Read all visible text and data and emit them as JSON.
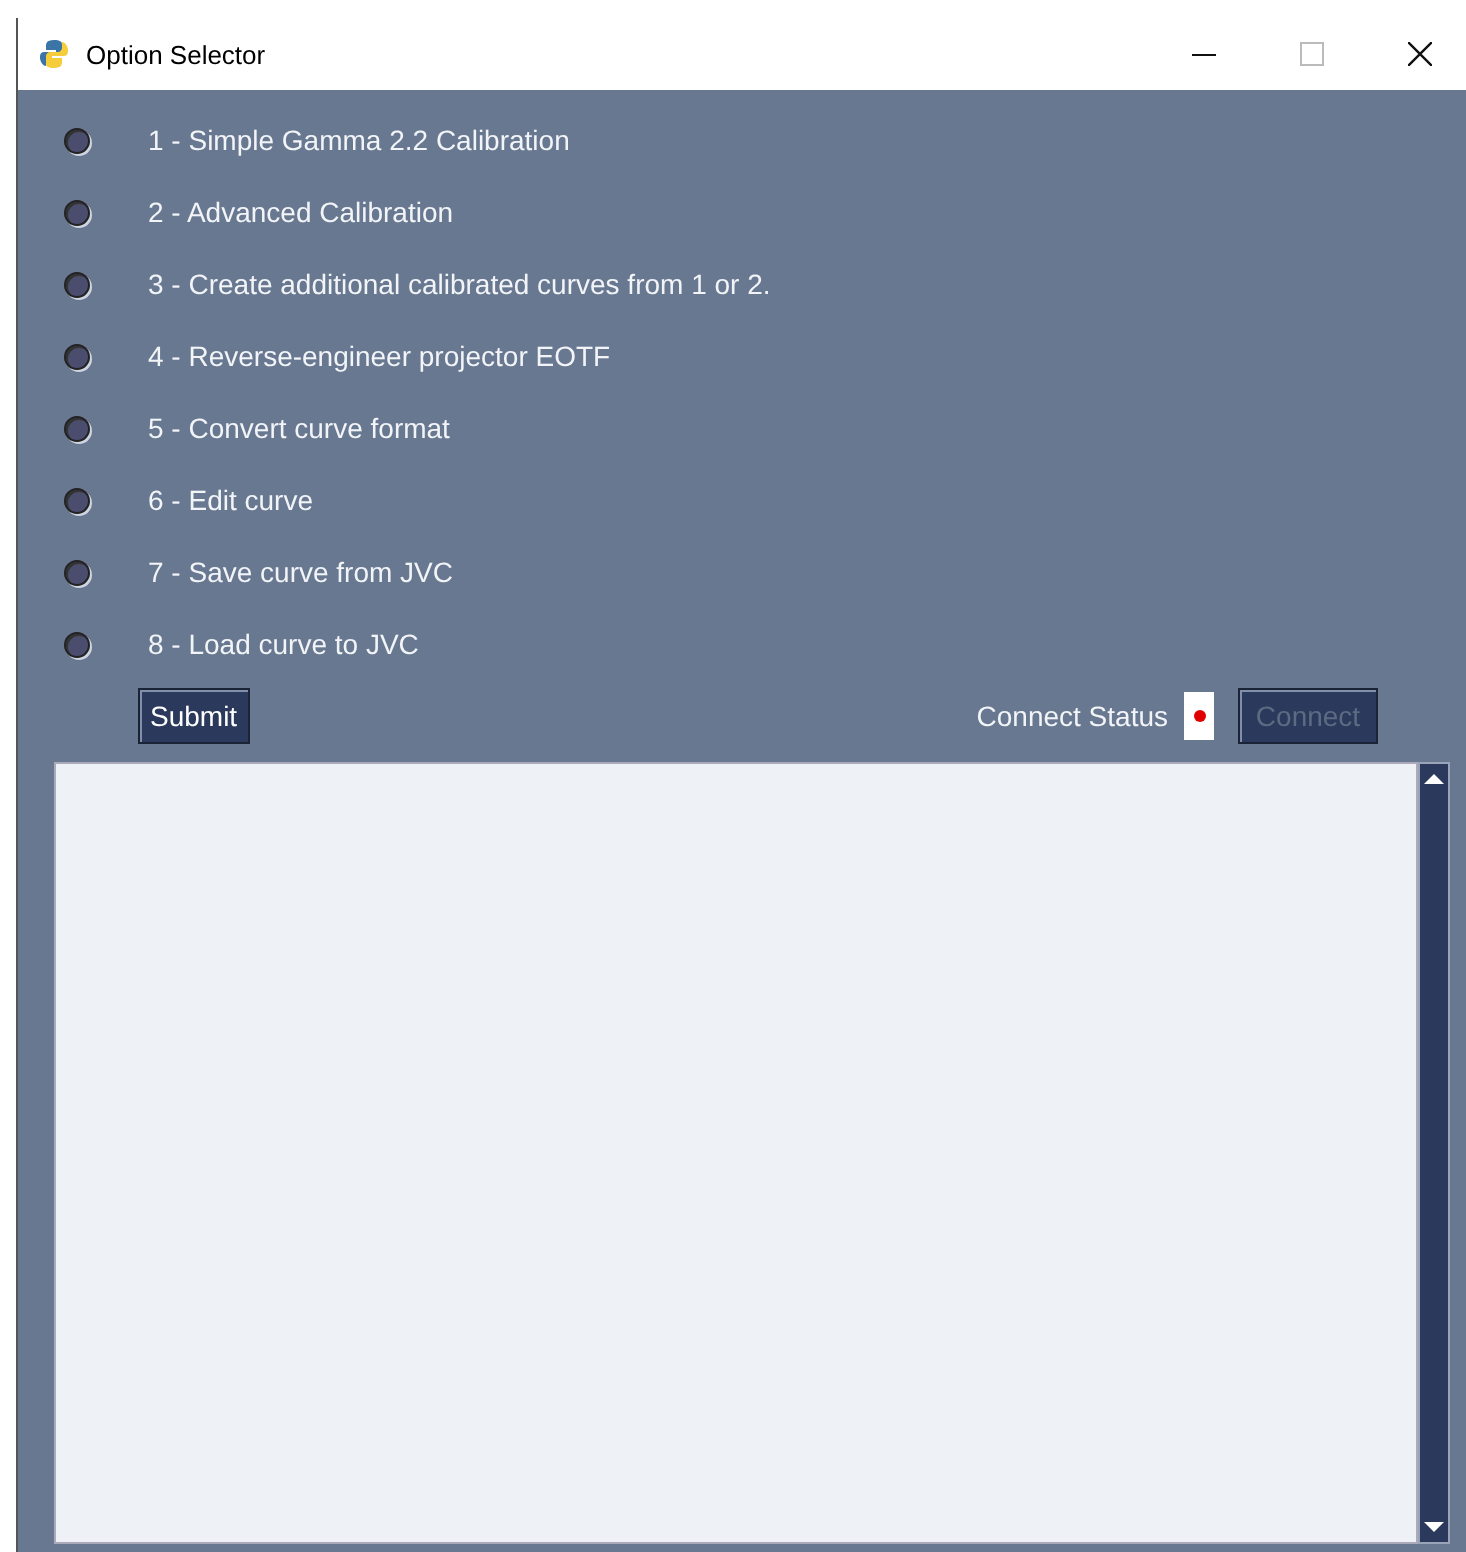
{
  "window": {
    "title": "Option Selector"
  },
  "options": [
    {
      "label": "1 - Simple Gamma 2.2 Calibration",
      "selected": false
    },
    {
      "label": "2 - Advanced Calibration",
      "selected": false
    },
    {
      "label": "3 - Create additional calibrated curves from 1 or 2.",
      "selected": false
    },
    {
      "label": "4 - Reverse-engineer projector EOTF",
      "selected": false
    },
    {
      "label": "5 - Convert curve format",
      "selected": false
    },
    {
      "label": "6 - Edit curve",
      "selected": false
    },
    {
      "label": "7 - Save curve from JVC",
      "selected": false
    },
    {
      "label": "8 - Load curve to JVC",
      "selected": false
    }
  ],
  "submit_button": "Submit",
  "connect_status": {
    "label": "Connect Status",
    "color": "#e00000"
  },
  "connect_button": {
    "label": "Connect",
    "disabled": true
  }
}
